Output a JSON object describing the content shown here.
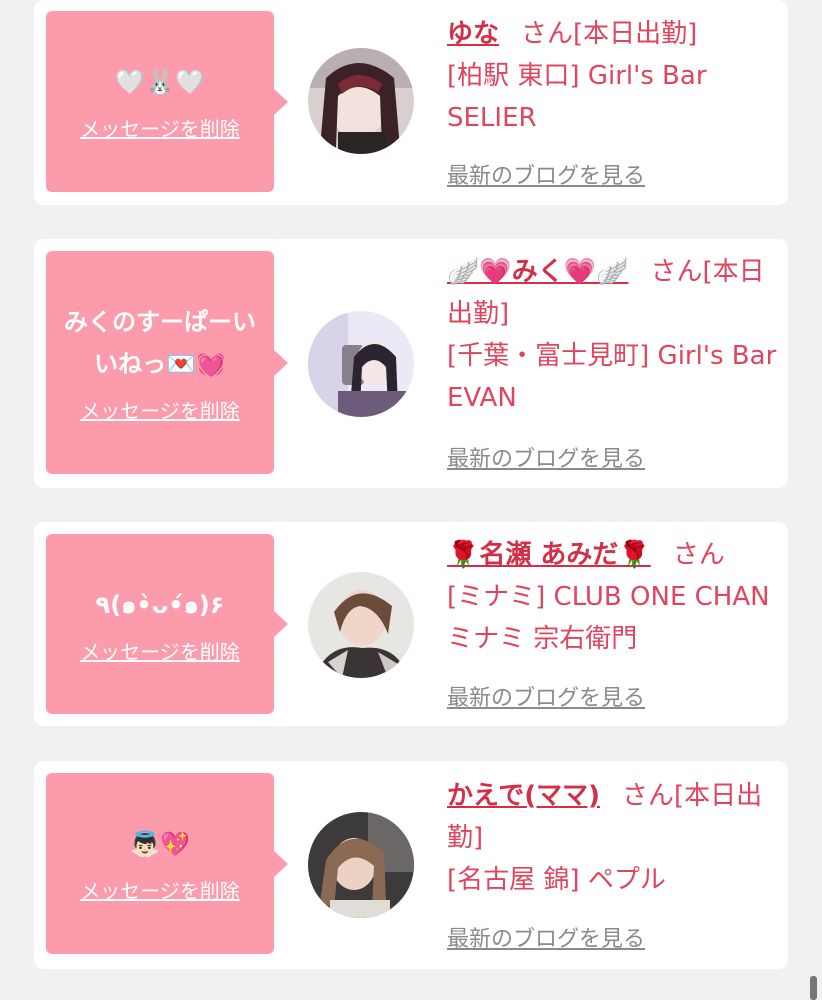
{
  "delete_label": "メッセージを削除",
  "blog_label": "最新のブログを見る",
  "colors": {
    "bubble": "#fb9bac",
    "name": "#d52f48",
    "text": "#e0455d",
    "link_gray": "#8a8a8a",
    "background": "#f1f1f1"
  },
  "entries": [
    {
      "message": "🤍🐰🤍",
      "name": "ゆな",
      "suffix": "さん[本日出勤]",
      "shop": "[柏駅 東口] Girl's Bar SELIER"
    },
    {
      "message": "みくのすーぱーい\nいねっ💌💓",
      "name": "🪽💗みく💗🪽",
      "suffix": "さん[本日出勤]",
      "shop": "[千葉・富士見町] Girl's Bar EVAN"
    },
    {
      "message": "٩(๑•̀ᴗ•́๑)۶",
      "name": "🌹名瀬 あみだ🌹",
      "suffix": "さん",
      "shop": "[ミナミ] CLUB ONE CHAN ミナミ 宗右衛門"
    },
    {
      "message": "👼🏻💖",
      "name": "かえで(ママ)",
      "suffix": "さん[本日出勤]",
      "shop": "[名古屋 錦] ペプル"
    }
  ]
}
